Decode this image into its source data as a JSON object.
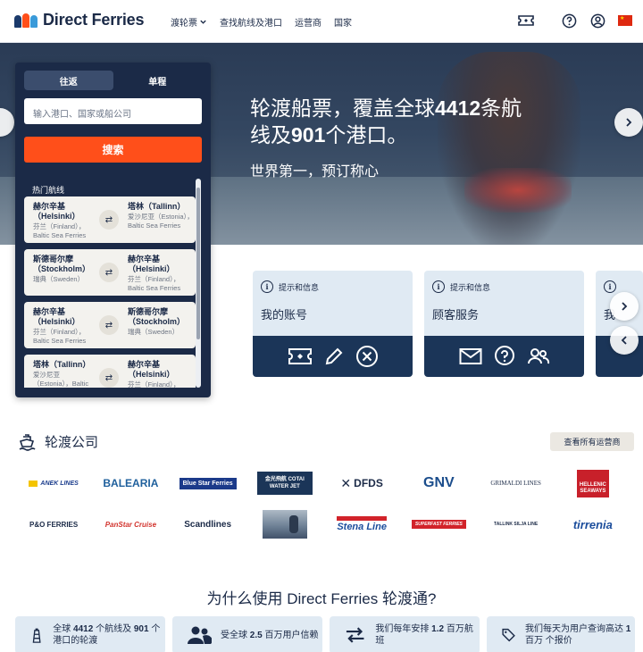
{
  "header": {
    "brand": "Direct Ferries",
    "nav": [
      {
        "label": "渡轮票",
        "has_dropdown": true
      },
      {
        "label": "查找航线及港口"
      },
      {
        "label": "运营商"
      },
      {
        "label": "国家"
      }
    ],
    "icons": [
      "ticket-icon",
      "help-icon",
      "account-icon",
      "china-flag-icon"
    ]
  },
  "hero": {
    "title_line1": "轮渡船票，覆盖全球",
    "title_bold1": "4412",
    "title_line1b": "条航",
    "title_line2a": "线及",
    "title_bold2": "901",
    "title_line2b": "个港口。",
    "subtitle": "世界第一，预订称心"
  },
  "booking": {
    "tabs": [
      "往返",
      "单程"
    ],
    "active_tab": 0,
    "search_placeholder": "输入港口、国家或船公司",
    "search_button": "搜索",
    "popular_label": "热门航线",
    "routes": [
      {
        "from_city": "赫尔辛基（Helsinki）",
        "from_country": "芬兰（Finland），Baltic Sea Ferries",
        "to_city": "塔林（Tallinn）",
        "to_country": "爱沙尼亚（Estonia），Baltic Sea Ferries"
      },
      {
        "from_city": "斯德哥尔摩（Stockholm）",
        "from_country": "瑞典（Sweden）",
        "to_city": "赫尔辛基（Helsinki）",
        "to_country": "芬兰（Finland），Baltic Sea Ferries"
      },
      {
        "from_city": "赫尔辛基（Helsinki）",
        "from_country": "芬兰（Finland），Baltic Sea Ferries",
        "to_city": "斯德哥尔摩（Stockholm）",
        "to_country": "瑞典（Sweden）"
      },
      {
        "from_city": "塔林（Tallinn）",
        "from_country": "爱沙尼亚（Estonia），Baltic",
        "to_city": "赫尔辛基（Helsinki）",
        "to_country": "芬兰（Finland），"
      }
    ]
  },
  "cards": [
    {
      "tag": "提示和信息",
      "title": "我的账号",
      "icons": [
        "ticket-icon",
        "pencil-icon",
        "cancel-icon"
      ]
    },
    {
      "tag": "提示和信息",
      "title": "顾客服务",
      "icons": [
        "mail-icon",
        "help-icon",
        "people-icon"
      ]
    },
    {
      "tag": "提示和信息",
      "title": "我"
    }
  ],
  "companies": {
    "title": "轮渡公司",
    "view_all": "查看所有运营商",
    "logos": [
      {
        "name": "ANEK LINES",
        "color": "#1a3c8c"
      },
      {
        "name": "BALEARIA",
        "color": "#1e5f9c"
      },
      {
        "name": "Blue Star Ferries",
        "color": "#1b3a8a"
      },
      {
        "name": "金光飛航 COTAI WATER JET",
        "color": "#1b3558"
      },
      {
        "name": "DFDS",
        "color": "#1b2a47"
      },
      {
        "name": "GNV",
        "color": "#1b4d8c"
      },
      {
        "name": "GRIMALDI LINES",
        "color": "#1b2a47"
      },
      {
        "name": "HELLENIC SEAWAYS",
        "color": "#c8202a"
      },
      {
        "name": "P&O FERRIES",
        "color": "#1b2a47"
      },
      {
        "name": "PanStar Cruise",
        "color": "#d2332d"
      },
      {
        "name": "Scandlines",
        "color": "#1b2a47"
      },
      {
        "name": "photo",
        "color": "#6a7d92"
      },
      {
        "name": "Stena Line",
        "color": "#1b4d9c"
      },
      {
        "name": "SUPERFAST FERRIES",
        "color": "#d2232a"
      },
      {
        "name": "TALLINK SILJA LINE",
        "color": "#1b2a47"
      },
      {
        "name": "tirrenia",
        "color": "#1b4d9c"
      }
    ]
  },
  "why": {
    "title": "为什么使用 Direct Ferries 轮渡通?",
    "items": [
      {
        "pre": "全球 ",
        "b1": "4412",
        "mid": " 个航线及 ",
        "b2": "901",
        "post": " 个港口的轮渡"
      },
      {
        "pre": "受全球 ",
        "b1": "2.5",
        "mid": " 百万用户信赖",
        "b2": "",
        "post": ""
      },
      {
        "pre": "我们每年安排 ",
        "b1": "1.2",
        "mid": " 百万航班",
        "b2": "",
        "post": ""
      },
      {
        "pre": "我们每天为用户查询高达 ",
        "b1": "1",
        "mid": " 百万 个报价",
        "b2": "",
        "post": ""
      }
    ]
  }
}
